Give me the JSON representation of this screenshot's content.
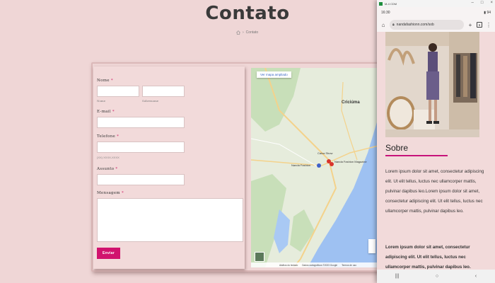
{
  "page": {
    "title": "Contato",
    "breadcrumb": {
      "current": "Contato"
    }
  },
  "form": {
    "name_label": "Nome",
    "name_first_sublabel": "Nome",
    "name_last_sublabel": "Sobrenome",
    "email_label": "E-mail",
    "phone_label": "Telefone",
    "phone_hint": "(XX) XXXX-XXXX",
    "subject_label": "Assunto",
    "message_label": "Mensagem",
    "required_mark": "*",
    "submit_label": "Enviar"
  },
  "map": {
    "view_larger": "Ver mapa ampliado",
    "labels": {
      "criciuma": "Criciúma",
      "nanda_fashion": "Nanda Fashion",
      "nanda_fashion_magazine": "Nanda Fashion Magazine",
      "caixa_show": "Caixa Show"
    },
    "footer": {
      "shortcuts": "Atalhos do teclado",
      "map_data": "Dados cartográficos ©2023 Google",
      "terms": "Termos de uso"
    },
    "colors": {
      "land": "#e6ecdc",
      "sea": "#9ec1f2",
      "green": "#c8dfb9",
      "road": "#f4d28b",
      "pin": "#d9342b"
    }
  },
  "browser_window": {
    "title": "M-4 CDM",
    "status": {
      "time": "16:30",
      "battery": "94"
    },
    "url": "nandafashionn.com/sob",
    "tabs_count": "6"
  },
  "mobile_page": {
    "about_heading": "Sobre",
    "about_text": "Lorem ipsum dolor sit amet, consectetur adipiscing elit. Ut elit tellus, luctus nec ullamcorper mattis, pulvinar dapibus leo.Lorem ipsum dolor sit amet, consectetur adipiscing elit. Ut elit tellus, luctus nec ullamcorper mattis, pulvinar dapibus leo.",
    "about_text_bold": "Lorem ipsum dolor sit amet, consectetur adipiscing elit. Ut elit tellus, luctus nec ullamcorper mattis, pulvinar dapibus leo.",
    "accent_color": "#c7137a"
  },
  "icons": {
    "home": "home-icon",
    "lock": "lock-icon",
    "add_tab": "plus-icon",
    "menu": "kebab-menu-icon",
    "nav_recent": "recent-apps-icon",
    "nav_home": "nav-home-icon",
    "nav_back": "back-icon"
  }
}
